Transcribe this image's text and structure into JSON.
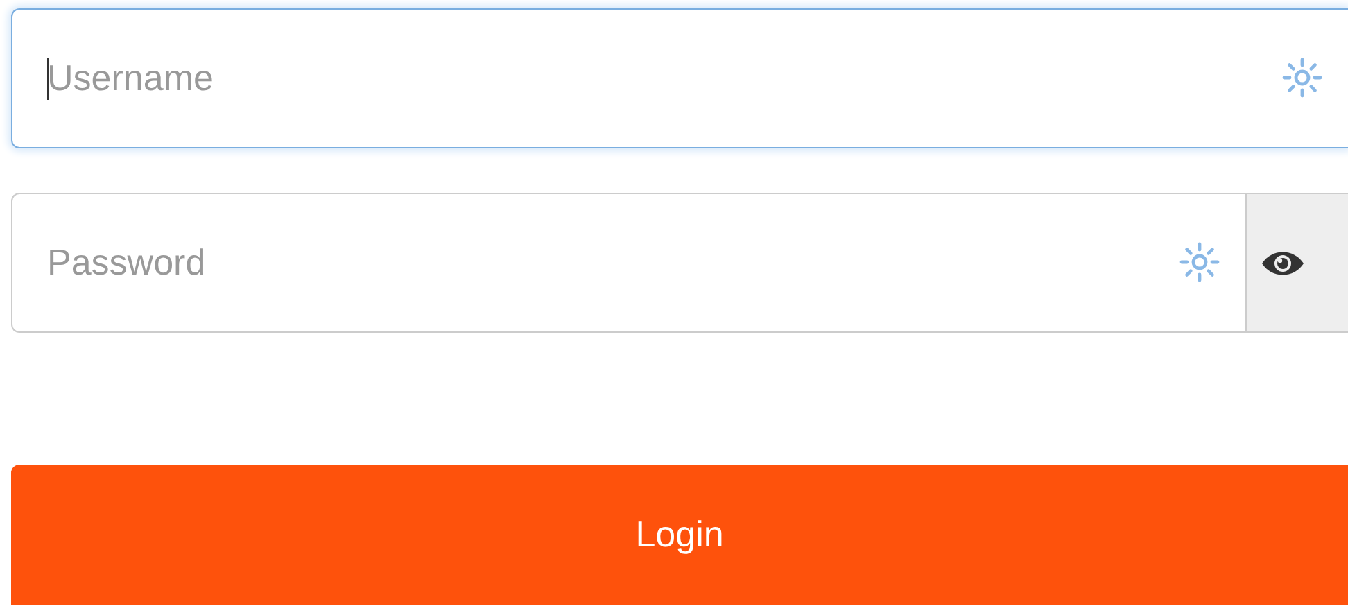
{
  "fields": [
    {
      "kind": "text",
      "placeholder": "Username",
      "focused": true
    },
    {
      "kind": "password",
      "placeholder": "Password",
      "focused": false
    }
  ],
  "login_button": {
    "label": "Login"
  }
}
